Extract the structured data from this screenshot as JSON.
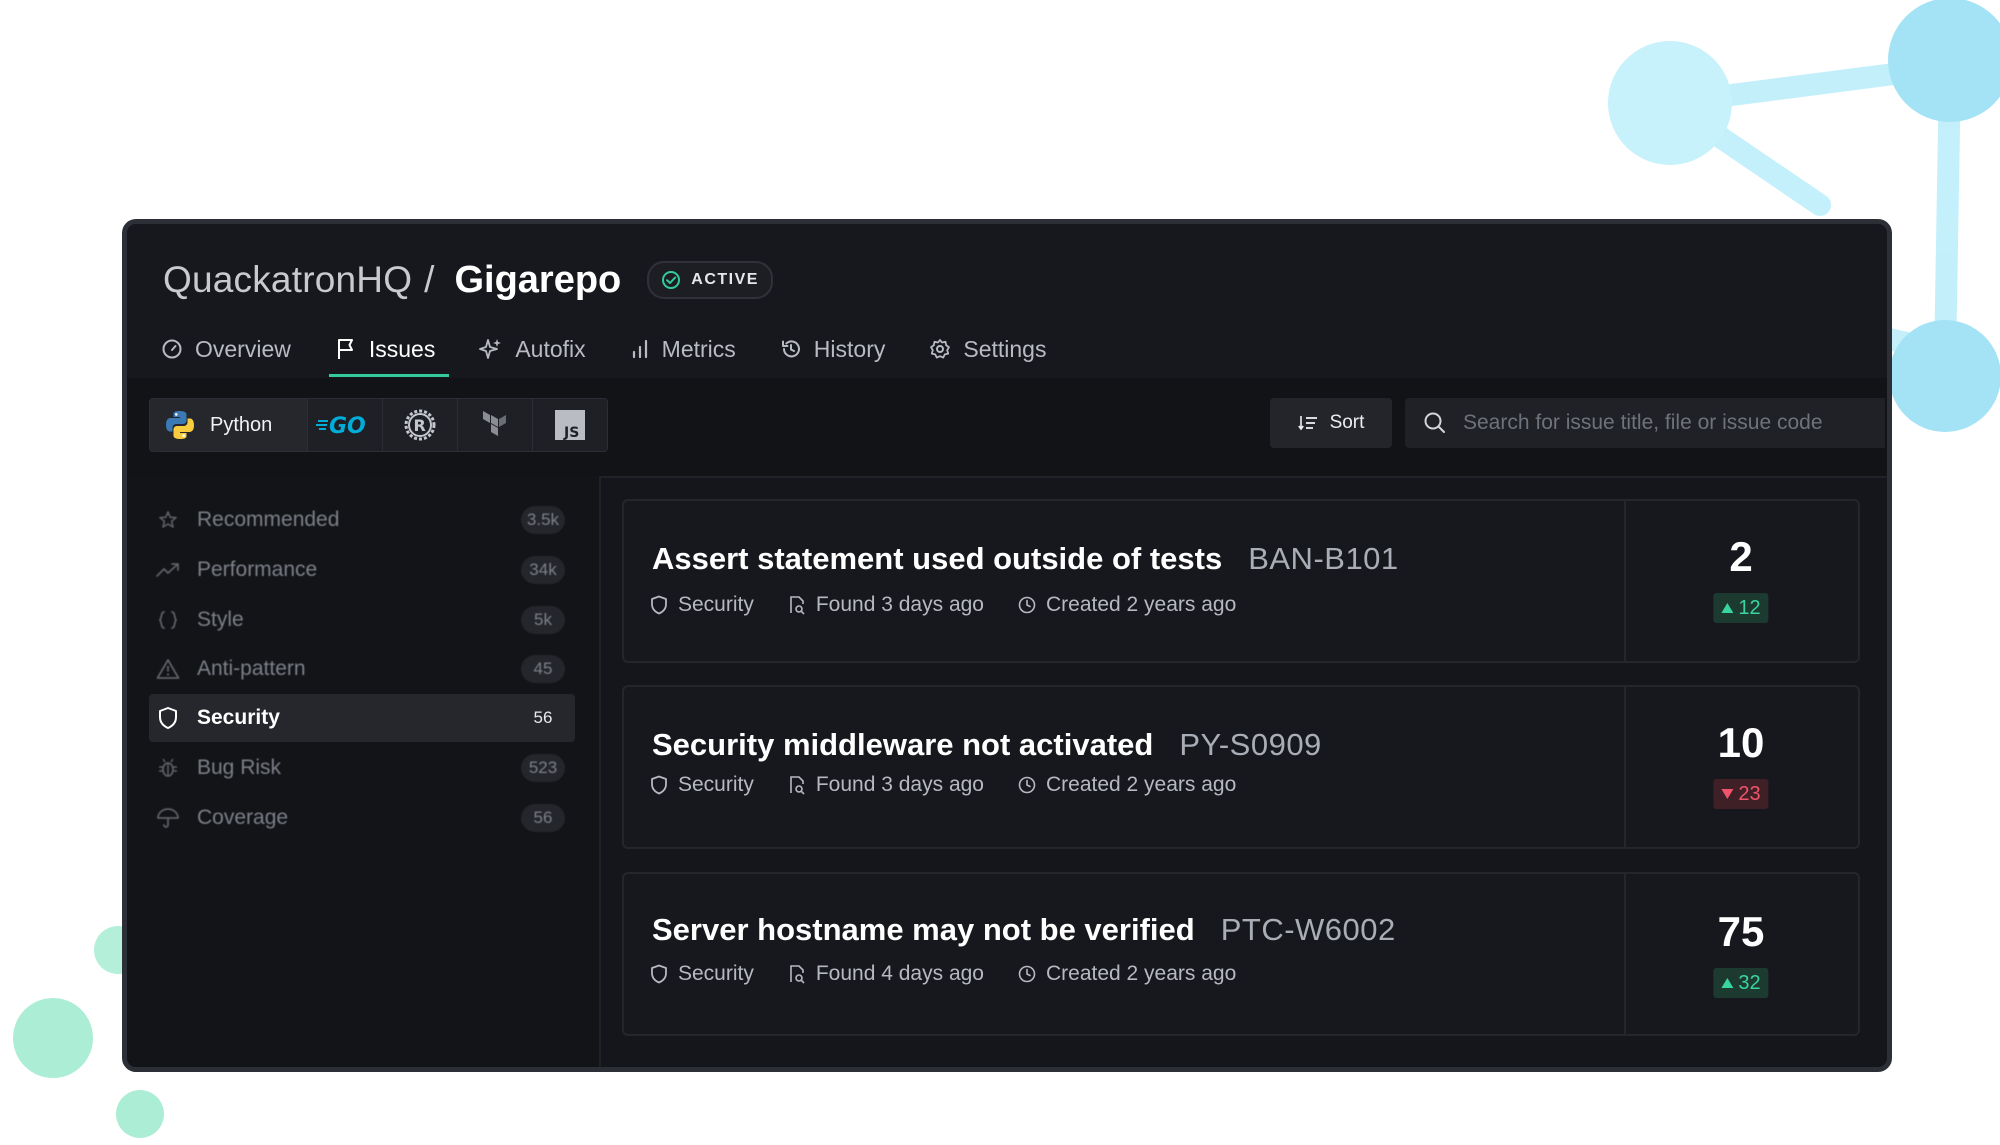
{
  "header": {
    "org": "QuackatronHQ",
    "separator": "/",
    "repo": "Gigarepo",
    "status_badge": "ACTIVE"
  },
  "tabs": [
    {
      "label": "Overview",
      "icon": "gauge-icon"
    },
    {
      "label": "Issues",
      "icon": "flag-icon",
      "active": true
    },
    {
      "label": "Autofix",
      "icon": "sparkles-icon"
    },
    {
      "label": "Metrics",
      "icon": "bar-chart-icon"
    },
    {
      "label": "History",
      "icon": "history-icon"
    },
    {
      "label": "Settings",
      "icon": "gear-icon"
    }
  ],
  "languages": [
    {
      "label": "Python",
      "icon": "python-icon",
      "active": true
    },
    {
      "label": "",
      "icon": "go-icon"
    },
    {
      "label": "",
      "icon": "rust-icon"
    },
    {
      "label": "",
      "icon": "terraform-icon"
    },
    {
      "label": "",
      "icon": "javascript-icon"
    }
  ],
  "toolbar": {
    "sort_label": "Sort",
    "search_placeholder": "Search for issue title, file or issue code"
  },
  "sidebar": {
    "items": [
      {
        "label": "Recommended",
        "count": "3.5k",
        "icon": "star-icon"
      },
      {
        "label": "Performance",
        "count": "34k",
        "icon": "trend-icon"
      },
      {
        "label": "Style",
        "count": "5k",
        "icon": "braces-icon"
      },
      {
        "label": "Anti-pattern",
        "count": "45",
        "icon": "warning-icon"
      },
      {
        "label": "Security",
        "count": "56",
        "icon": "shield-icon",
        "active": true
      },
      {
        "label": "Bug Risk",
        "count": "523",
        "icon": "bug-icon"
      },
      {
        "label": "Coverage",
        "count": "56",
        "icon": "umbrella-icon"
      }
    ]
  },
  "issues": [
    {
      "title": "Assert statement used outside of tests",
      "code": "BAN-B101",
      "category": "Security",
      "found": "Found 3 days ago",
      "created": "Created 2 years ago",
      "count": "2",
      "delta": "12",
      "trend": "up"
    },
    {
      "title": "Security middleware not activated",
      "code": "PY-S0909",
      "category": "Security",
      "found": "Found 3 days ago",
      "created": "Created 2 years ago",
      "count": "10",
      "delta": "23",
      "trend": "down"
    },
    {
      "title": "Server hostname may not be verified",
      "code": "PTC-W6002",
      "category": "Security",
      "found": "Found 4 days ago",
      "created": "Created 2 years ago",
      "count": "75",
      "delta": "32",
      "trend": "up"
    }
  ],
  "colors": {
    "accent": "#33cb9a",
    "trend_up": "#39d49f",
    "trend_down": "#f0546a",
    "background": "#15161b",
    "decoration_blue": "#a9e6f7",
    "decoration_green": "#a6ecd2"
  }
}
